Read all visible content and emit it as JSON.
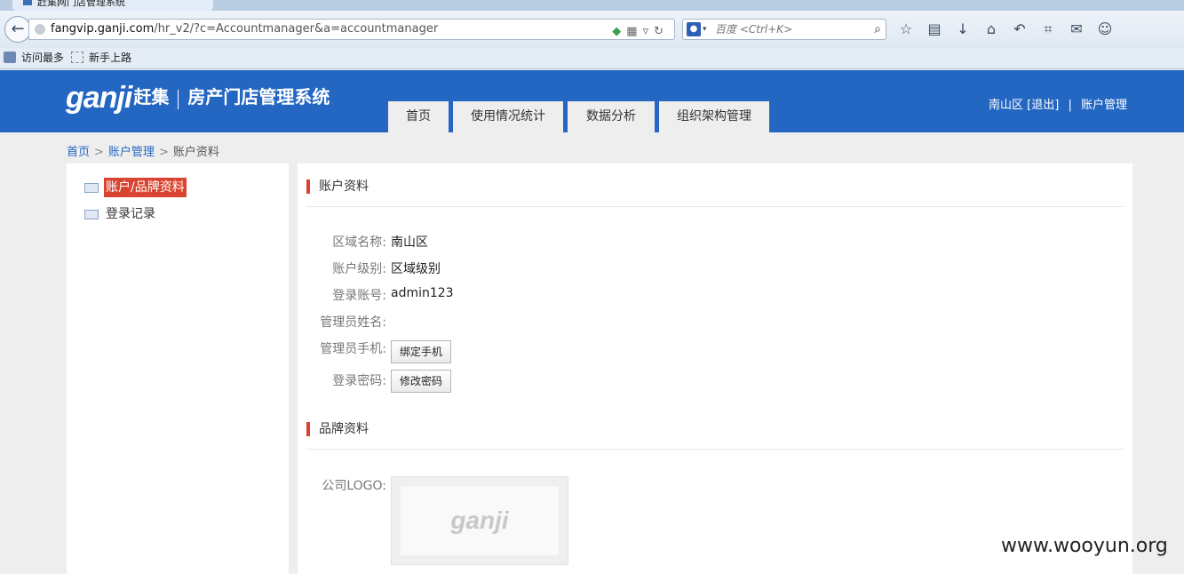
{
  "browser": {
    "tab_title": "赶集网门店管理系统",
    "url_host": "fangvip.ganji.com",
    "url_path": "/hr_v2/?c=Accountmanager&a=accountmanager",
    "search_placeholder": "百度 <Ctrl+K>",
    "search_engine": "baidu-icon",
    "bookmarks": [
      {
        "label": "访问最多"
      },
      {
        "label": "新手上路"
      }
    ]
  },
  "header": {
    "logo_word": "ganji",
    "logo_cn": "赶集",
    "system_title": "房产门店管理系统",
    "bg_color": "#2467c3",
    "nav": [
      {
        "label": "首页"
      },
      {
        "label": "使用情况统计"
      },
      {
        "label": "数据分析"
      },
      {
        "label": "组织架构管理"
      }
    ],
    "user": {
      "district": "南山区",
      "logout": "[退出]",
      "divider": "|",
      "account_mgmt": "账户管理"
    }
  },
  "breadcrumb": {
    "items": [
      "首页",
      "账户管理",
      "账户资料"
    ],
    "sep": ">"
  },
  "sidebar": {
    "items": [
      {
        "label": "账户/品牌资料",
        "active": true
      },
      {
        "label": "登录记录",
        "active": false
      }
    ]
  },
  "account": {
    "section_title": "账户资料",
    "fields": {
      "region": {
        "label": "区域名称:",
        "value": "南山区"
      },
      "level": {
        "label": "账户级别:",
        "value": "区域级别"
      },
      "login": {
        "label": "登录账号:",
        "value": "admin123"
      },
      "admin_name": {
        "label": "管理员姓名:",
        "value": ""
      },
      "admin_phone": {
        "label": "管理员手机:",
        "button": "绑定手机"
      },
      "password": {
        "label": "登录密码:",
        "button": "修改密码"
      }
    }
  },
  "brand": {
    "section_title": "品牌资料",
    "logo_label": "公司LOGO:",
    "logo_placeholder": "ganji"
  },
  "watermark": "www.wooyun.org",
  "accent_color": "#d9432f"
}
